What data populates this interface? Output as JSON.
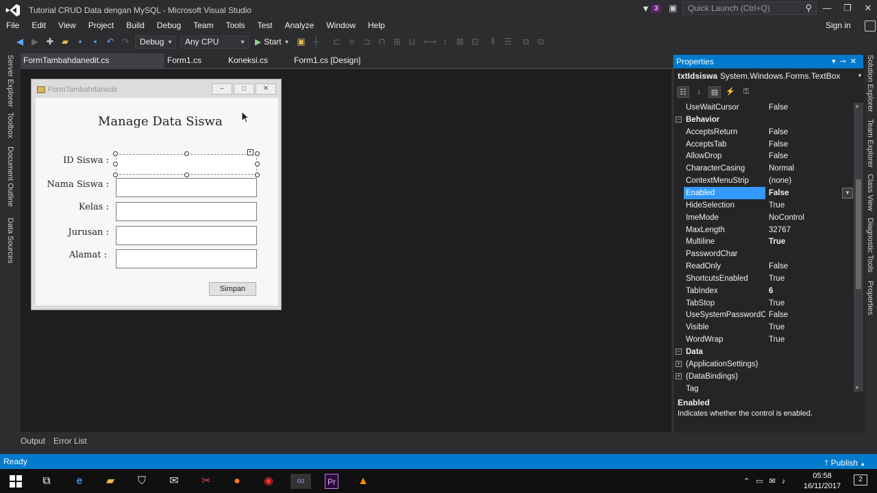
{
  "window": {
    "title": "Tutorial CRUD Data dengan MySQL - Microsoft Visual Studio",
    "notification_count": "3"
  },
  "quick_launch": {
    "placeholder": "Quick Launch (Ctrl+Q)"
  },
  "menu": [
    "File",
    "Edit",
    "View",
    "Project",
    "Build",
    "Debug",
    "Team",
    "Tools",
    "Test",
    "Analyze",
    "Window",
    "Help"
  ],
  "signin_label": "Sign in",
  "toolbar": {
    "configuration": "Debug",
    "platform": "Any CPU",
    "start_label": "Start"
  },
  "left_rail": [
    "Server Explorer",
    "Toolbox",
    "Document Outline",
    "Data Sources"
  ],
  "doc_tabs": [
    {
      "label": "FormTambahdanedit.cs [Design]*",
      "active": true
    },
    {
      "label": "Form1.cs"
    },
    {
      "label": "Koneksi.cs"
    },
    {
      "label": "Form1.cs [Design]"
    }
  ],
  "form": {
    "title": "FormTambahdanedit",
    "heading": "Manage Data Siswa",
    "labels": {
      "id": "ID Siswa :",
      "nama": "Nama Siswa :",
      "kelas": "Kelas :",
      "jurusan": "Jurusan :",
      "alamat": "Alamat :"
    },
    "submit_label": "Simpan"
  },
  "properties": {
    "header": "Properties",
    "object_name": "txtIdsiswa",
    "object_type": "System.Windows.Forms.TextBox",
    "rows": [
      {
        "name": "UseWaitCursor",
        "value": "False"
      },
      {
        "name": "Behavior",
        "category": true
      },
      {
        "name": "AcceptsReturn",
        "value": "False"
      },
      {
        "name": "AcceptsTab",
        "value": "False"
      },
      {
        "name": "AllowDrop",
        "value": "False"
      },
      {
        "name": "CharacterCasing",
        "value": "Normal"
      },
      {
        "name": "ContextMenuStrip",
        "value": "(none)"
      },
      {
        "name": "Enabled",
        "value": "False",
        "bold": true,
        "selected": true
      },
      {
        "name": "HideSelection",
        "value": "True"
      },
      {
        "name": "ImeMode",
        "value": "NoControl"
      },
      {
        "name": "MaxLength",
        "value": "32767"
      },
      {
        "name": "Multiline",
        "value": "True",
        "bold": true
      },
      {
        "name": "PasswordChar",
        "value": ""
      },
      {
        "name": "ReadOnly",
        "value": "False"
      },
      {
        "name": "ShortcutsEnabled",
        "value": "True"
      },
      {
        "name": "TabIndex",
        "value": "6",
        "bold": true
      },
      {
        "name": "TabStop",
        "value": "True"
      },
      {
        "name": "UseSystemPasswordChar",
        "value": "False"
      },
      {
        "name": "Visible",
        "value": "True"
      },
      {
        "name": "WordWrap",
        "value": "True"
      },
      {
        "name": "Data",
        "category": true
      },
      {
        "name": "(ApplicationSettings)",
        "value": "",
        "expandable": true
      },
      {
        "name": "(DataBindings)",
        "value": "",
        "expandable": true
      },
      {
        "name": "Tag",
        "value": ""
      }
    ],
    "description_title": "Enabled",
    "description_text": "Indicates whether the control is enabled."
  },
  "right_rail": [
    "Solution Explorer",
    "Team Explorer",
    "Class View",
    "Diagnostic Tools",
    "Properties"
  ],
  "bottom_tabs": [
    "Output",
    "Error List"
  ],
  "status": {
    "text": "Ready",
    "publish": "Publish"
  },
  "taskbar": {
    "time": "05:58",
    "date": "16/11/2017",
    "notifications": "2"
  }
}
